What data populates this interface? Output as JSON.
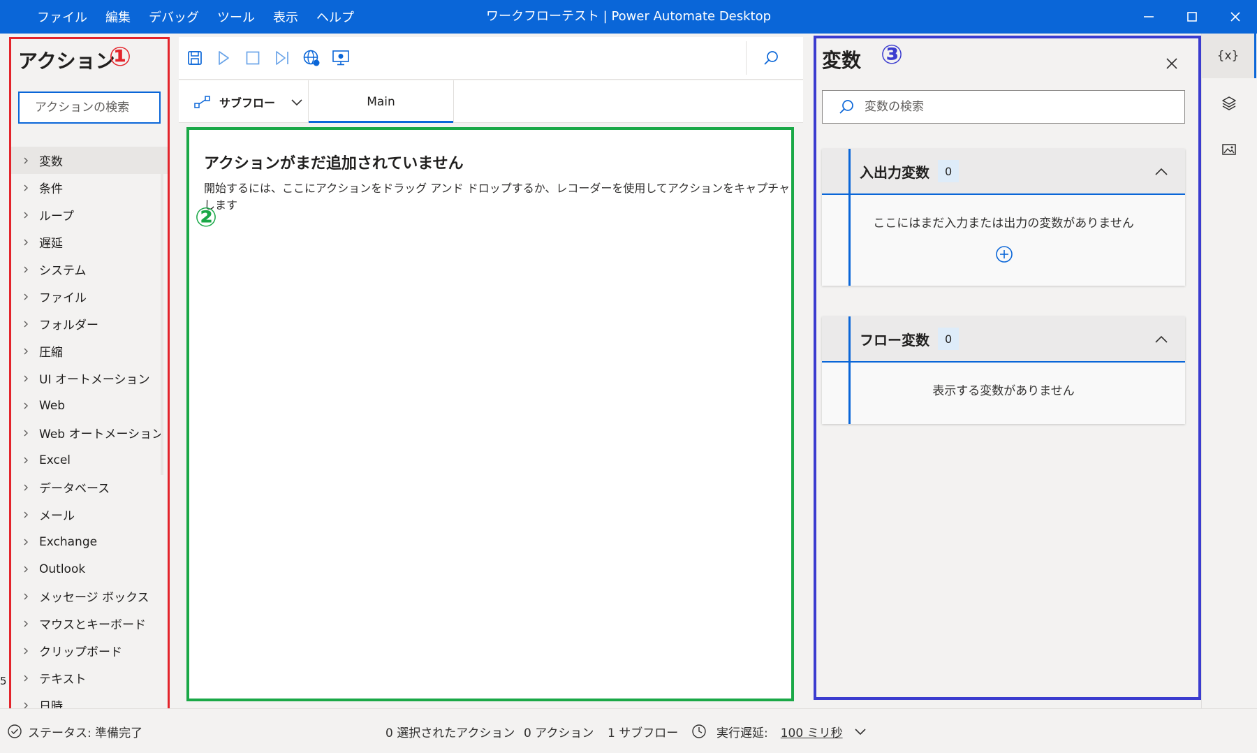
{
  "menu": [
    "ファイル",
    "編集",
    "デバッグ",
    "ツール",
    "表示",
    "ヘルプ"
  ],
  "window_title": "ワークフローテスト | Power Automate Desktop",
  "annotations": {
    "one": "①",
    "two": "②",
    "three": "③"
  },
  "actions_panel": {
    "title": "アクション",
    "search_placeholder": "アクションの検索",
    "items": [
      "変数",
      "条件",
      "ループ",
      "遅延",
      "システム",
      "ファイル",
      "フォルダー",
      "圧縮",
      "UI オートメーション",
      "Web",
      "Web オートメーション",
      "Excel",
      "データベース",
      "メール",
      "Exchange",
      "Outlook",
      "メッセージ ボックス",
      "マウスとキーボード",
      "クリップボード",
      "テキスト",
      "日時"
    ]
  },
  "toolbar": {
    "icons": [
      "save-icon",
      "run-icon",
      "stop-icon",
      "run-next-action-icon",
      "web-recorder-icon",
      "desktop-recorder-icon",
      "search-icon"
    ]
  },
  "tabs": {
    "subflow_label": "サブフロー",
    "main_tab": "Main"
  },
  "canvas": {
    "empty_title": "アクションがまだ追加されていません",
    "empty_hint": "開始するには、ここにアクションをドラッグ アンド ドロップするか、レコーダーを使用してアクションをキャプチャします"
  },
  "variables_panel": {
    "title": "変数",
    "search_placeholder": "変数の検索",
    "io_section": {
      "title": "入出力変数",
      "count": "0",
      "empty_text": "ここにはまだ入力または出力の変数がありません"
    },
    "flow_section": {
      "title": "フロー変数",
      "count": "0",
      "empty_text": "表示する変数がありません"
    }
  },
  "side_strip": {
    "variables_label": "{x}",
    "icons": [
      "variables-icon",
      "layers-icon",
      "images-icon"
    ]
  },
  "status": {
    "state": "ステータス: 準備完了",
    "selected": "0 選択されたアクション",
    "actions": "0 アクション",
    "subflows": "1 サブフロー",
    "delay_label": "実行遅延:",
    "delay_value": "100 ミリ秒"
  },
  "edge_text": "5",
  "colors": {
    "accent": "#0a66d8",
    "box_red": "#e3242b",
    "box_green": "#1aa847",
    "box_blue": "#3b3ccf"
  }
}
